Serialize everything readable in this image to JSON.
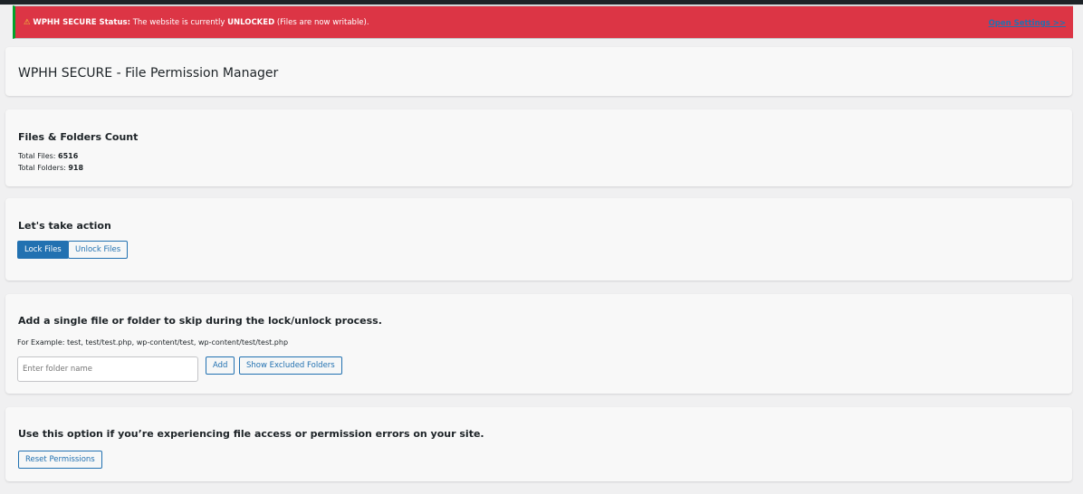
{
  "notice": {
    "icon": "warning-icon",
    "prefix": "WPHH SECURE Status:",
    "text1": " The website is currently ",
    "state": "UNLOCKED",
    "text2": " (Files are now writable).",
    "link": "Open Settings >>"
  },
  "header": {
    "title": "WPHH SECURE - File Permission Manager"
  },
  "counts": {
    "title": "Files & Folders Count",
    "files_label": "Total Files: ",
    "files": "6516",
    "folders_label": "Total Folders: ",
    "folders": "918"
  },
  "action": {
    "title": "Let's take action",
    "lock": "Lock Files",
    "unlock": "Unlock Files"
  },
  "exclude": {
    "title": "Add a single file or folder to skip during the lock/unlock process.",
    "example": "For Example: test, test/test.php, wp-content/test, wp-content/test/test.php",
    "placeholder": "Enter folder name",
    "add": "Add",
    "show": "Show Excluded Folders"
  },
  "reset": {
    "title": "Use this option if you’re experiencing file access or permission errors on your site.",
    "button": "Reset Permissions"
  }
}
